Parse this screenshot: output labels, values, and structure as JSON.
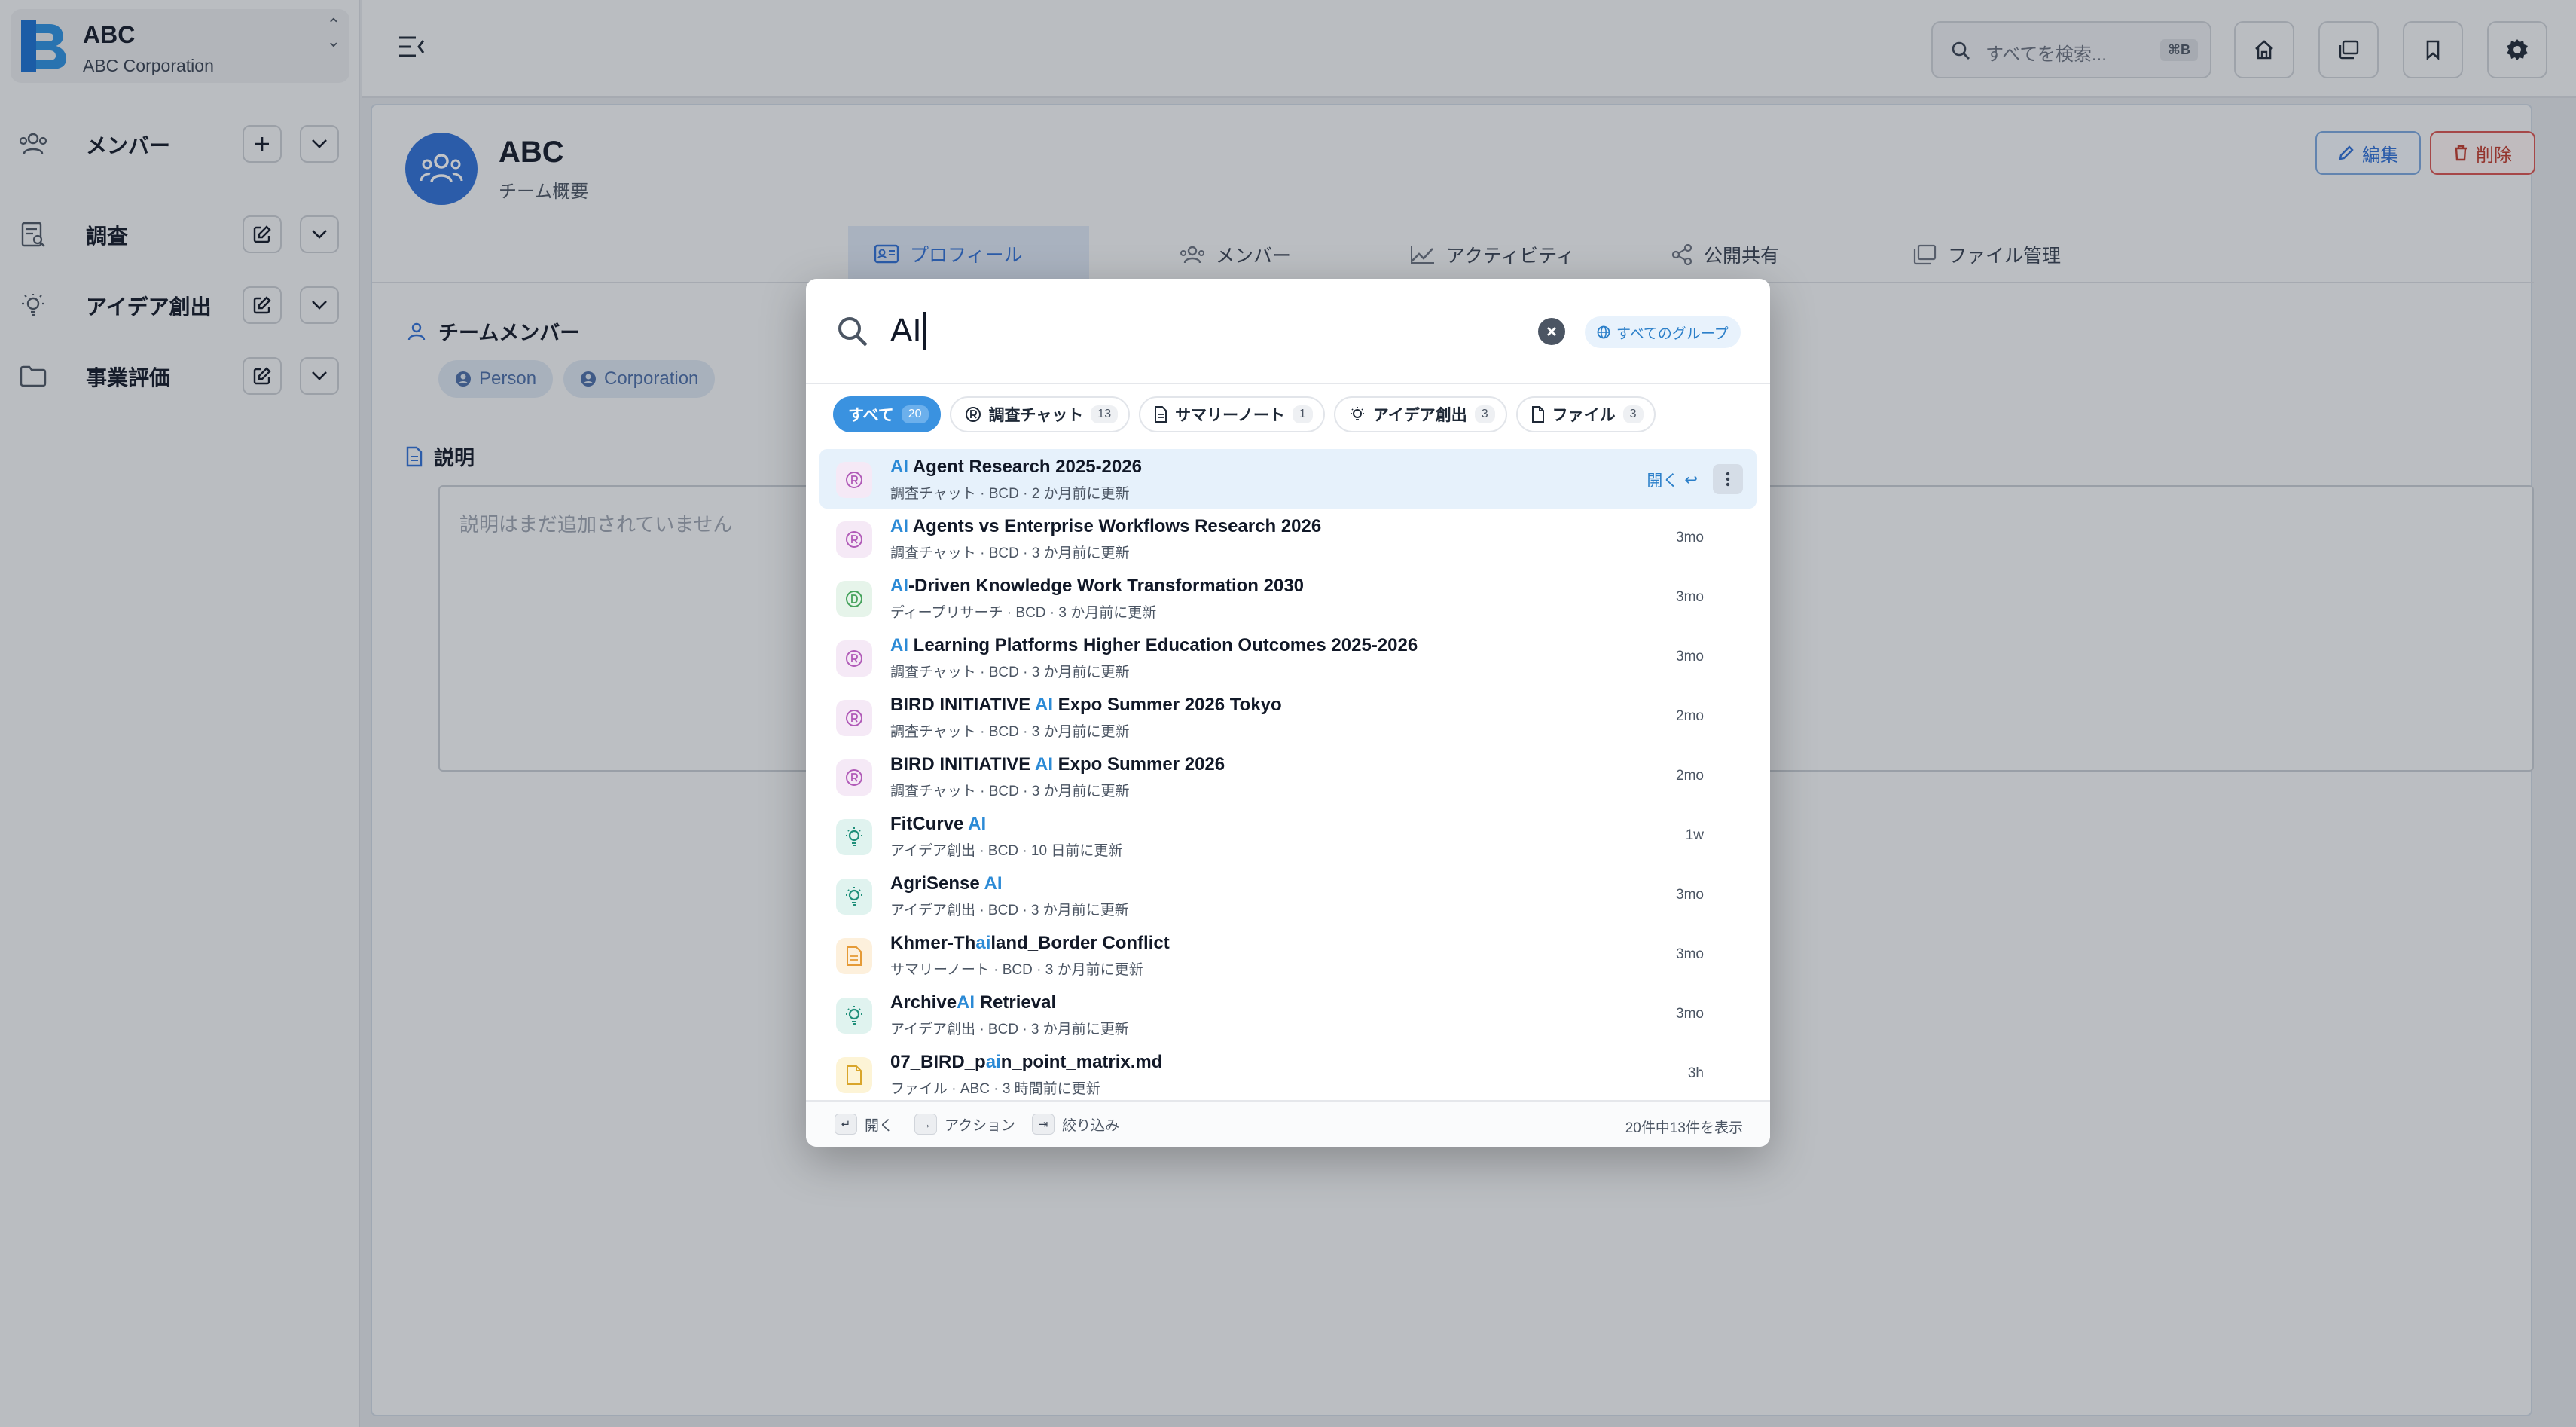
{
  "brand": {
    "name": "ABC",
    "subtitle": "ABC Corporation"
  },
  "sidebar": {
    "items": [
      {
        "label": "メンバー",
        "icon": "users-icon"
      },
      {
        "label": "調査",
        "icon": "research-doc-icon"
      },
      {
        "label": "アイデア創出",
        "icon": "lightbulb-icon"
      },
      {
        "label": "事業評価",
        "icon": "folder-icon"
      }
    ]
  },
  "header": {
    "search_placeholder": "すべてを検索...",
    "search_shortcut": "⌘B"
  },
  "team": {
    "name": "ABC",
    "subtitle": "チーム概要",
    "edit_label": "編集",
    "delete_label": "削除",
    "tabs": [
      {
        "label": "プロフィール",
        "active": true
      },
      {
        "label": "メンバー",
        "active": false
      },
      {
        "label": "アクティビティ",
        "active": false
      },
      {
        "label": "公開共有",
        "active": false
      },
      {
        "label": "ファイル管理",
        "active": false
      }
    ],
    "members_title": "チームメンバー",
    "members": [
      "Person",
      "Corporation"
    ],
    "description_title": "説明",
    "description_placeholder": "説明はまだ追加されていません"
  },
  "palette": {
    "query": "AI",
    "scope_label": "すべてのグループ",
    "filters": [
      {
        "label": "すべて",
        "count": "20",
        "active": true,
        "icon": ""
      },
      {
        "label": "調査チャット",
        "count": "13",
        "active": false,
        "icon": "research-chat-icon"
      },
      {
        "label": "サマリーノート",
        "count": "1",
        "active": false,
        "icon": "document-icon"
      },
      {
        "label": "アイデア創出",
        "count": "3",
        "active": false,
        "icon": "lightbulb-icon"
      },
      {
        "label": "ファイル",
        "count": "3",
        "active": false,
        "icon": "file-icon"
      }
    ],
    "results": [
      {
        "pre": "",
        "hl": "AI",
        "post": " Agent Research 2025-2026",
        "meta": "調査チャット · BCD · 2 か月前に更新",
        "time": "",
        "type": "research",
        "selected": true
      },
      {
        "pre": "",
        "hl": "AI",
        "post": " Agents vs Enterprise Workflows Research 2026",
        "meta": "調査チャット · BCD · 3 か月前に更新",
        "time": "3mo",
        "type": "research",
        "selected": false
      },
      {
        "pre": "",
        "hl": "AI",
        "post": "-Driven Knowledge Work Transformation 2030",
        "meta": "ディープリサーチ · BCD · 3 か月前に更新",
        "time": "3mo",
        "type": "deep",
        "selected": false
      },
      {
        "pre": "",
        "hl": "AI",
        "post": " Learning Platforms Higher Education Outcomes 2025-2026",
        "meta": "調査チャット · BCD · 3 か月前に更新",
        "time": "3mo",
        "type": "research",
        "selected": false
      },
      {
        "pre": "BIRD INITIATIVE ",
        "hl": "AI",
        "post": " Expo Summer 2026 Tokyo",
        "meta": "調査チャット · BCD · 3 か月前に更新",
        "time": "2mo",
        "type": "research",
        "selected": false
      },
      {
        "pre": "BIRD INITIATIVE ",
        "hl": "AI",
        "post": " Expo Summer 2026",
        "meta": "調査チャット · BCD · 3 か月前に更新",
        "time": "2mo",
        "type": "research",
        "selected": false
      },
      {
        "pre": "FitCurve ",
        "hl": "AI",
        "post": "",
        "meta": "アイデア創出 · BCD · 10 日前に更新",
        "time": "1w",
        "type": "idea",
        "selected": false
      },
      {
        "pre": "AgriSense ",
        "hl": "AI",
        "post": "",
        "meta": "アイデア創出 · BCD · 3 か月前に更新",
        "time": "3mo",
        "type": "idea",
        "selected": false
      },
      {
        "pre": "Khmer-Th",
        "hl": "ai",
        "post": "land_Border Conflict",
        "meta": "サマリーノート · BCD · 3 か月前に更新",
        "time": "3mo",
        "type": "note",
        "selected": false
      },
      {
        "pre": "Archive",
        "hl": "AI",
        "post": " Retrieval",
        "meta": "アイデア創出 · BCD · 3 か月前に更新",
        "time": "3mo",
        "type": "idea",
        "selected": false
      },
      {
        "pre": "07_BIRD_p",
        "hl": "ai",
        "post": "n_point_matrix.md",
        "meta": "ファイル · ABC · 3 時間前に更新",
        "time": "3h",
        "type": "file",
        "selected": false
      }
    ],
    "open_label": "開く",
    "footer": {
      "hint_open": "開く",
      "hint_action": "アクション",
      "hint_filter": "絞り込み",
      "count_text": "20件中13件を表示"
    }
  },
  "colors": {
    "accent": "#3a92e0",
    "brand": "#2f6fd6",
    "danger": "#c0392b",
    "highlight": "#2b8ad6"
  }
}
